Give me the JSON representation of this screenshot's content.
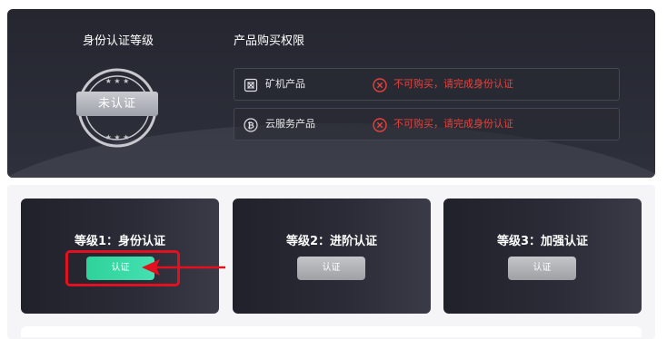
{
  "identity": {
    "title": "身份认证等级",
    "badge_text": "未认证"
  },
  "permissions": {
    "title": "产品购买权限",
    "rows": [
      {
        "icon": "mining-machine-icon",
        "name": "矿机产品",
        "status": "不可购买，请完成身份认证"
      },
      {
        "icon": "bitcoin-icon",
        "name": "云服务产品",
        "status": "不可购买，请完成身份认证"
      }
    ]
  },
  "levels": [
    {
      "title": "等级1：身份认证",
      "button": "认证",
      "state": "active"
    },
    {
      "title": "等级2：进阶认证",
      "button": "认证",
      "state": "disabled"
    },
    {
      "title": "等级3：加强认证",
      "button": "认证",
      "state": "disabled"
    }
  ],
  "colors": {
    "error": "#e8413c",
    "active_button": "#2fd29a",
    "highlight": "#e3101f"
  }
}
